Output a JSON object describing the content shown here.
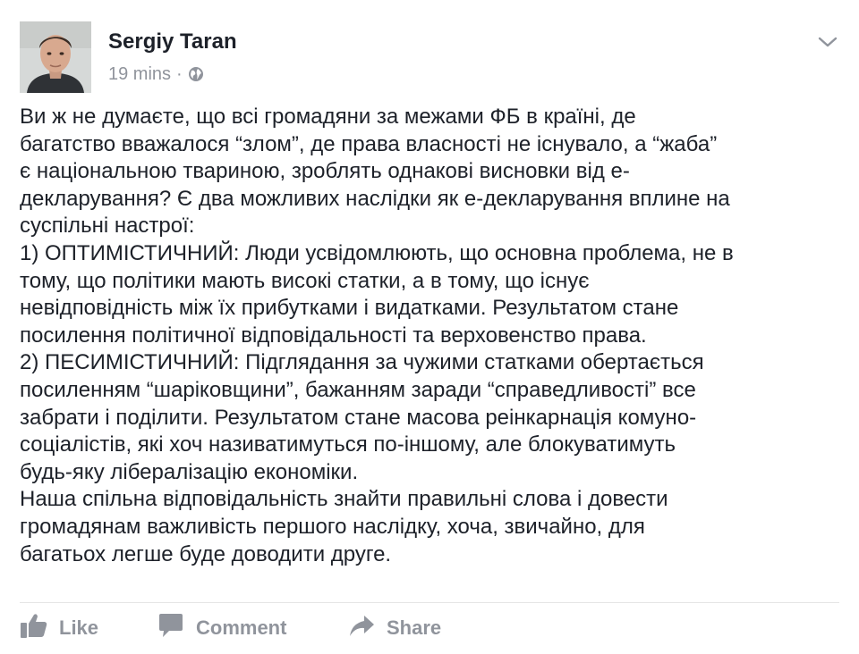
{
  "post": {
    "author": "Sergiy Taran",
    "time": "19 mins",
    "separator": "·",
    "privacy_icon": "globe-icon",
    "menu_icon": "chevron-down-icon",
    "body_lines": [
      "Ви ж не думаєте, що всі громадяни за межами ФБ в країні, де",
      "багатство вважалося “злом”, де права власності не існувало, а “жаба”",
      "є національною твариною, зроблять однакові висновки від е-",
      "декларування? Є два можливих наслідки як е-декларування вплине на",
      "суспільні настрої:",
      "1) ОПТИМІСТИЧНИЙ: Люди усвідомлюють, що основна проблема, не в",
      "тому, що політики мають високі статки, а в тому, що існує",
      "невідповідність між їх прибутками і видатками. Результатом стане",
      "посилення політичної відповідальності та верховенство права.",
      "2) ПЕСИМІСТИЧНИЙ: Підглядання за чужими статками обертається",
      "посиленням “шаріковщини”, бажанням заради “справедливості” все",
      "забрати і поділити. Результатом стане масова реінкарнація комуно-",
      "соціалістів, які хоч називатимуться по-іншому, але блокуватимуть",
      "будь-яку лібералізацію економіки.",
      "Наша спільна відповідальність знайти правильні слова і довести",
      "громадянам важливість першого наслідку, хоча, звичайно, для",
      "багатьох легше буде доводити друге."
    ]
  },
  "actions": {
    "like_label": "Like",
    "like_icon": "thumbs-up-icon",
    "comment_label": "Comment",
    "comment_icon": "speech-bubble-icon",
    "share_label": "Share",
    "share_icon": "share-arrow-icon"
  },
  "colors": {
    "text": "#1d2129",
    "muted": "#90949c",
    "divider": "#e5e5e5"
  }
}
